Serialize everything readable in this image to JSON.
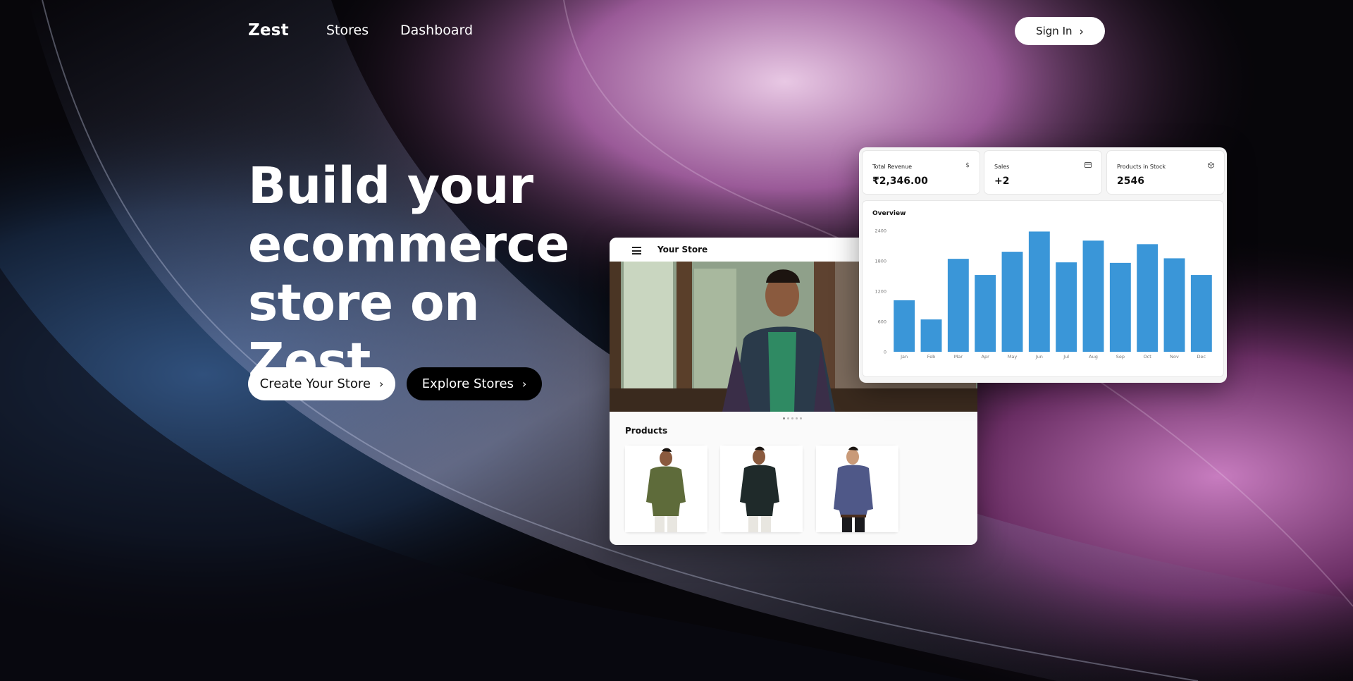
{
  "nav": {
    "brand": "Zest",
    "links": [
      "Stores",
      "Dashboard"
    ],
    "signin_label": "Sign In"
  },
  "hero": {
    "title_lines": [
      "Build your",
      "ecommerce",
      "store on Zest"
    ],
    "create_label": "Create Your Store",
    "explore_label": "Explore Stores"
  },
  "store_preview": {
    "store_name": "Your Store",
    "products_label": "Products"
  },
  "dashboard": {
    "stats": [
      {
        "label": "Total Revenue",
        "value": "₹2,346.00",
        "icon": "dollar-icon"
      },
      {
        "label": "Sales",
        "value": "+2",
        "icon": "credit-card-icon"
      },
      {
        "label": "Products in Stock",
        "value": "2546",
        "icon": "package-icon"
      }
    ],
    "overview_title": "Overview"
  },
  "chart_data": {
    "type": "bar",
    "categories": [
      "Jan",
      "Feb",
      "Mar",
      "Apr",
      "May",
      "Jun",
      "Jul",
      "Aug",
      "Sep",
      "Oct",
      "Nov",
      "Dec"
    ],
    "values": [
      1020,
      640,
      1840,
      1520,
      1980,
      2380,
      1770,
      2200,
      1760,
      2130,
      1850,
      1520
    ],
    "y_ticks": [
      "0",
      "600",
      "1200",
      "1800",
      "2400"
    ],
    "ylim": [
      0,
      2400
    ],
    "bar_color": "#3a96d8"
  },
  "colors": {
    "accent_bar": "#3a96d8"
  }
}
